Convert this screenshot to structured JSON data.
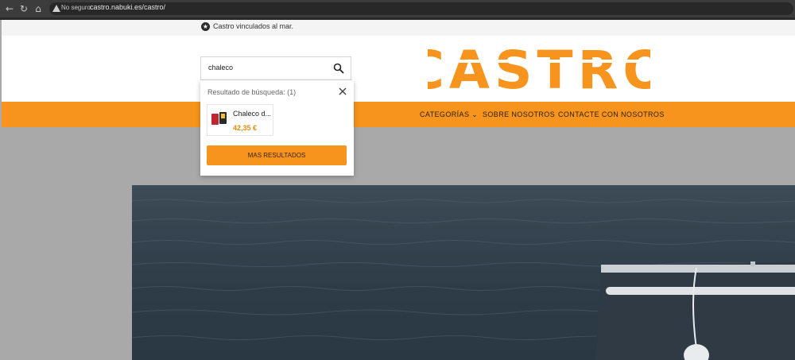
{
  "browser": {
    "security_label": "No seguro",
    "url": "castro.nabuki.es/castro/"
  },
  "topbar": {
    "message": "Castro vinculados al mar."
  },
  "search": {
    "value": "chaleco"
  },
  "dropdown": {
    "results_label": "Resultado de búsqueda: (1)",
    "result": {
      "name": "Chaleco d...",
      "price": "42,35 €"
    },
    "more_button": "MAS RESULTADOS"
  },
  "logo": {
    "text": "CASTRO",
    "color": "#f7941d"
  },
  "nav": {
    "items": [
      {
        "label": "CATEGORÍAS ⌄"
      },
      {
        "label": "SOBRE NOSOTROS"
      },
      {
        "label": "CONTACTE CON NOSOTROS"
      }
    ]
  },
  "colors": {
    "accent": "#f7941d"
  }
}
